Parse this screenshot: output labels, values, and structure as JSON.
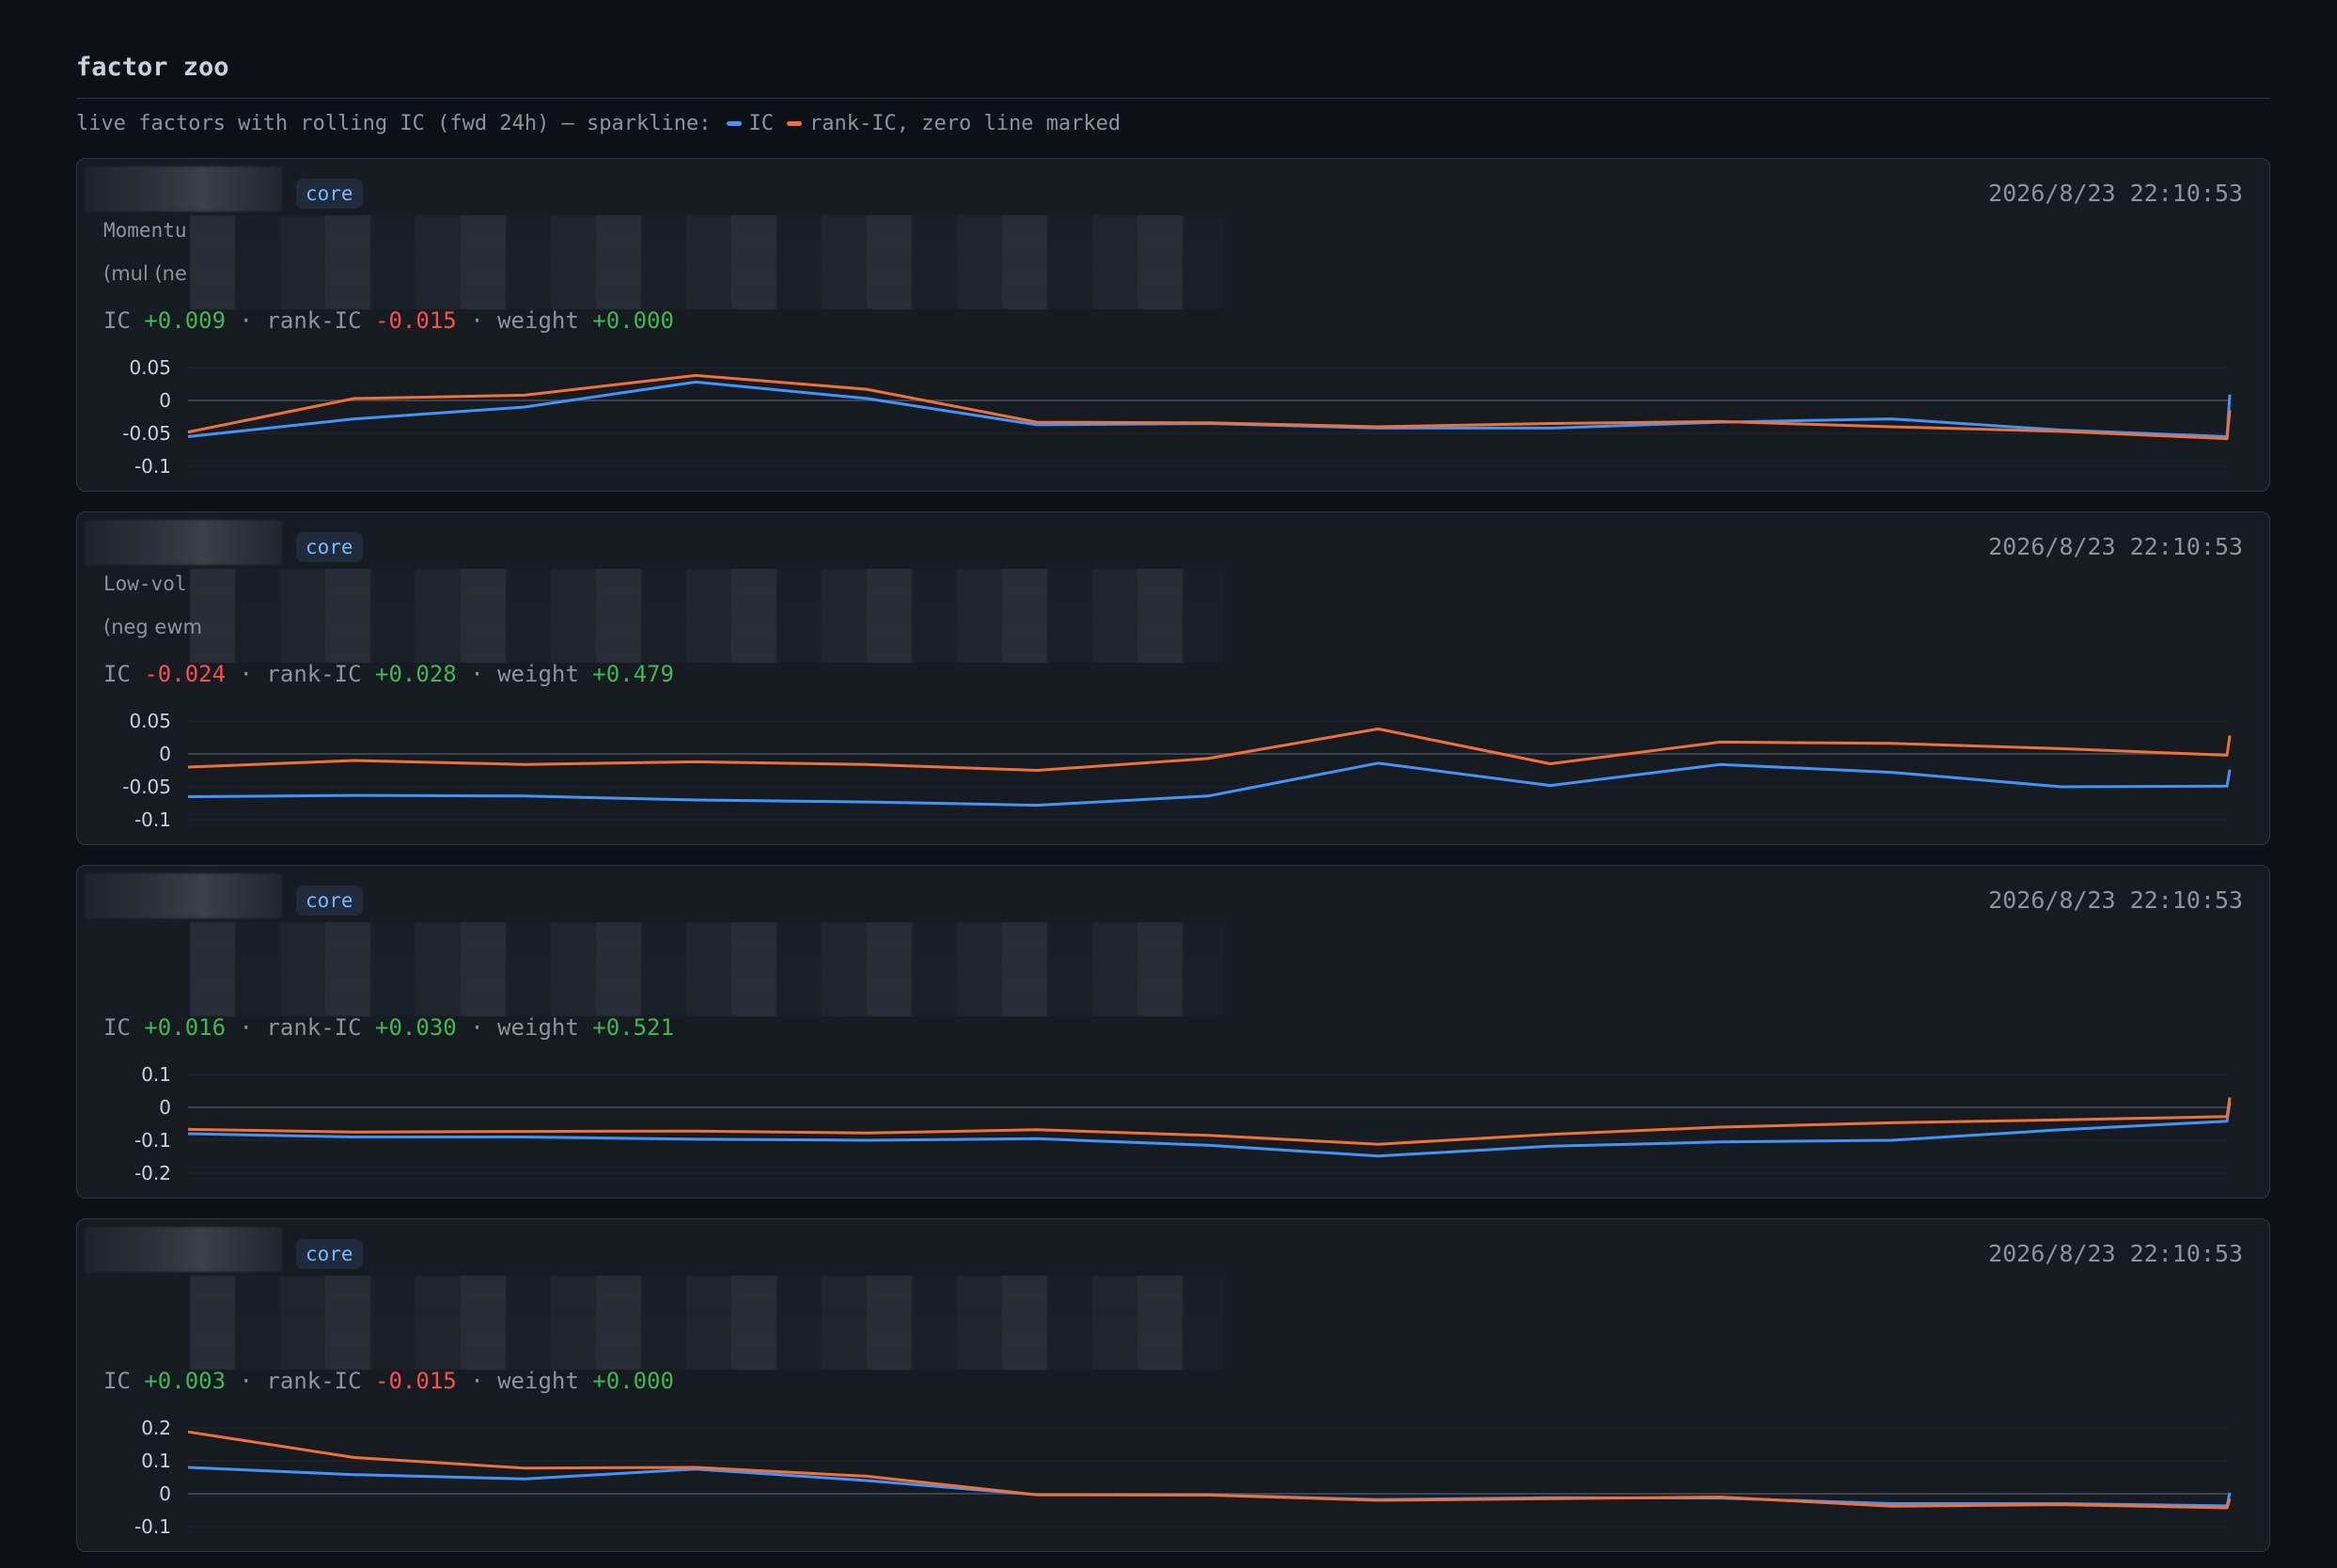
{
  "page": {
    "title": "factor zoo",
    "subtitle": "live factors with rolling IC (fwd 24h) — sparkline:",
    "legend": [
      {
        "label": "IC",
        "color": "#4493f8"
      },
      {
        "label": "rank-IC, zero line marked",
        "color": "#f0703a"
      }
    ]
  },
  "labels": {
    "ic": "IC",
    "rank_ic": "rank-IC",
    "weight": "weight",
    "sep": "·"
  },
  "colors": {
    "ic": "#4493f8",
    "rank_ic": "#f0703a",
    "zero_line": "#3d444d",
    "grid": "#21262d"
  },
  "factors": [
    {
      "badge": "core",
      "timestamp": "2026/8/23 22:10:53",
      "description": "Momentu",
      "formula": "(mul (ne",
      "ic": "+0.009",
      "rank_ic": "-0.015",
      "weight": "+0.000",
      "chart_data": {
        "type": "line",
        "yticks": [
          "0.05",
          "0",
          "-0.05",
          "-0.1"
        ],
        "ylim": [
          -0.1,
          0.05
        ],
        "series": [
          {
            "key": "ic",
            "values": [
              -0.055,
              -0.028,
              -0.01,
              0.028,
              0.003,
              -0.037,
              -0.035,
              -0.042,
              -0.042,
              -0.033,
              -0.028,
              -0.045,
              -0.055,
              0.009
            ]
          },
          {
            "key": "rank_ic",
            "values": [
              -0.048,
              0.003,
              0.008,
              0.038,
              0.017,
              -0.033,
              -0.034,
              -0.04,
              -0.035,
              -0.032,
              -0.04,
              -0.047,
              -0.058,
              -0.015
            ]
          }
        ]
      }
    },
    {
      "badge": "core",
      "timestamp": "2026/8/23 22:10:53",
      "description": "Low-vol",
      "formula": "(neg ewm",
      "ic": "-0.024",
      "rank_ic": "+0.028",
      "weight": "+0.479",
      "chart_data": {
        "type": "line",
        "yticks": [
          "0.05",
          "0",
          "-0.05",
          "-0.1"
        ],
        "ylim": [
          -0.1,
          0.05
        ],
        "series": [
          {
            "key": "ic",
            "values": [
              -0.065,
              -0.063,
              -0.064,
              -0.07,
              -0.073,
              -0.078,
              -0.064,
              -0.014,
              -0.048,
              -0.016,
              -0.028,
              -0.05,
              -0.049,
              -0.024
            ]
          },
          {
            "key": "rank_ic",
            "values": [
              -0.02,
              -0.01,
              -0.016,
              -0.012,
              -0.016,
              -0.025,
              -0.007,
              0.038,
              -0.015,
              0.018,
              0.016,
              0.008,
              -0.002,
              0.028
            ]
          }
        ]
      }
    },
    {
      "badge": "core",
      "timestamp": "2026/8/23 22:10:53",
      "description": "",
      "formula": "",
      "ic": "+0.016",
      "rank_ic": "+0.030",
      "weight": "+0.521",
      "chart_data": {
        "type": "line",
        "yticks": [
          "0.1",
          "0",
          "-0.1",
          "-0.2"
        ],
        "ylim": [
          -0.2,
          0.1
        ],
        "series": [
          {
            "key": "ic",
            "values": [
              -0.08,
              -0.09,
              -0.09,
              -0.097,
              -0.1,
              -0.095,
              -0.115,
              -0.148,
              -0.118,
              -0.105,
              -0.1,
              -0.068,
              -0.042,
              0.016
            ]
          },
          {
            "key": "rank_ic",
            "values": [
              -0.067,
              -0.075,
              -0.073,
              -0.072,
              -0.078,
              -0.068,
              -0.085,
              -0.112,
              -0.082,
              -0.06,
              -0.047,
              -0.038,
              -0.028,
              0.03
            ]
          }
        ]
      }
    },
    {
      "badge": "core",
      "timestamp": "2026/8/23 22:10:53",
      "description": "",
      "formula": "",
      "ic": "+0.003",
      "rank_ic": "-0.015",
      "weight": "+0.000",
      "chart_data": {
        "type": "line",
        "yticks": [
          "0.2",
          "0.1",
          "0",
          "-0.1"
        ],
        "ylim": [
          -0.1,
          0.2
        ],
        "series": [
          {
            "key": "ic",
            "values": [
              0.08,
              0.058,
              0.045,
              0.075,
              0.04,
              -0.003,
              -0.003,
              -0.018,
              -0.012,
              -0.013,
              -0.03,
              -0.03,
              -0.037,
              0.003
            ]
          },
          {
            "key": "rank_ic",
            "values": [
              0.188,
              0.11,
              0.078,
              0.08,
              0.053,
              -0.003,
              -0.004,
              -0.02,
              -0.015,
              -0.01,
              -0.038,
              -0.033,
              -0.043,
              -0.015
            ]
          }
        ]
      }
    }
  ]
}
